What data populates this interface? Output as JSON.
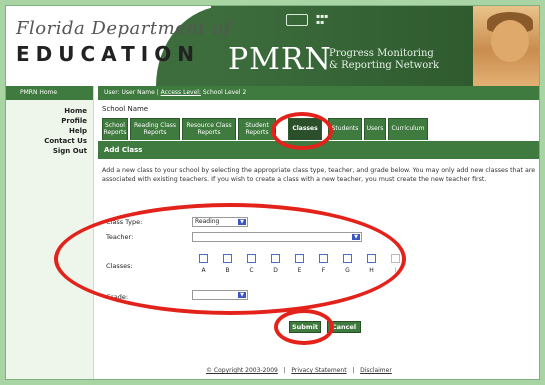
{
  "header": {
    "logo_script": "Florida Department of",
    "logo_main": "EDUCATION",
    "app_name": "PMRN",
    "app_subtitle_line1": "Progress Monitoring",
    "app_subtitle_line2": "& Reporting Network"
  },
  "leftnav": {
    "home_bar": "PMRN Home",
    "items": [
      "Home",
      "Profile",
      "Help",
      "Contact Us",
      "Sign Out"
    ]
  },
  "userbar": {
    "user_text": "User: User Name  |",
    "access_label": "Access Level:",
    "access_value": "School Level 2"
  },
  "school_name": "School Name",
  "tabs": [
    {
      "line1": "School",
      "line2": "Reports"
    },
    {
      "line1": "Reading Class",
      "line2": "Reports"
    },
    {
      "line1": "Resource Class",
      "line2": "Reports"
    },
    {
      "line1": "Student",
      "line2": "Reports"
    },
    {
      "line1": "Classes",
      "line2": ""
    },
    {
      "line1": "Students",
      "line2": ""
    },
    {
      "line1": "Users",
      "line2": ""
    },
    {
      "line1": "Curriculum",
      "line2": ""
    }
  ],
  "active_tab": "Classes",
  "section_title": "Add Class",
  "intro_text": "Add a new class to your school by selecting the appropriate class type, teacher, and grade below. You may only add new classes that are associated with existing teachers. If you wish to create a class with a new teacher, you must create the new teacher first.",
  "form": {
    "class_type_label": "Class Type:",
    "class_type_value": "Reading",
    "teacher_label": "Teacher:",
    "teacher_value": "",
    "classes_label": "Classes:",
    "class_letters": [
      "A",
      "B",
      "C",
      "D",
      "E",
      "F",
      "G",
      "H",
      "I"
    ],
    "grade_label": "Grade:",
    "grade_value": "",
    "submit_label": "Submit",
    "cancel_label": "Cancel"
  },
  "footer": {
    "copyright": "© Copyright 2003-2009",
    "privacy": "Privacy Statement",
    "disclaimer": "Disclaimer",
    "separator": "|"
  },
  "colors": {
    "accent_green": "#3f7a3f",
    "highlight_red": "#e3231b",
    "frame_green": "#a8d5a3"
  }
}
